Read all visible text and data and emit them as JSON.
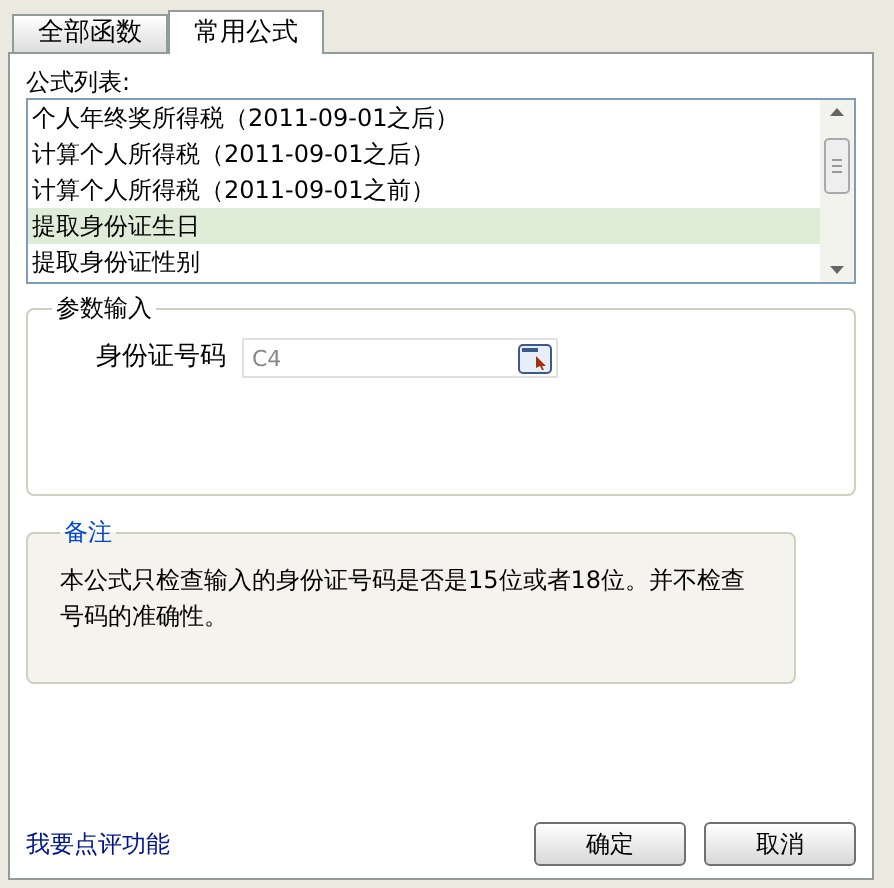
{
  "tabs": [
    {
      "label": "全部函数",
      "selected": false
    },
    {
      "label": "常用公式",
      "selected": true
    }
  ],
  "formula_list": {
    "label": "公式列表:",
    "items": [
      {
        "label": "个人年终奖所得税（2011-09-01之后）",
        "selected": false
      },
      {
        "label": "计算个人所得税（2011-09-01之后）",
        "selected": false
      },
      {
        "label": "计算个人所得税（2011-09-01之前）",
        "selected": false
      },
      {
        "label": "提取身份证生日",
        "selected": true
      },
      {
        "label": "提取身份证性别",
        "selected": false
      }
    ]
  },
  "parameters": {
    "title": "参数输入",
    "fields": [
      {
        "label": "身份证号码",
        "value": "C4"
      }
    ]
  },
  "note": {
    "title": "备注",
    "text": "本公式只检查输入的身份证号码是否是15位或者18位。并不检查号码的准确性。"
  },
  "footer": {
    "link": "我要点评功能",
    "buttons": [
      "确定",
      "取消"
    ]
  }
}
